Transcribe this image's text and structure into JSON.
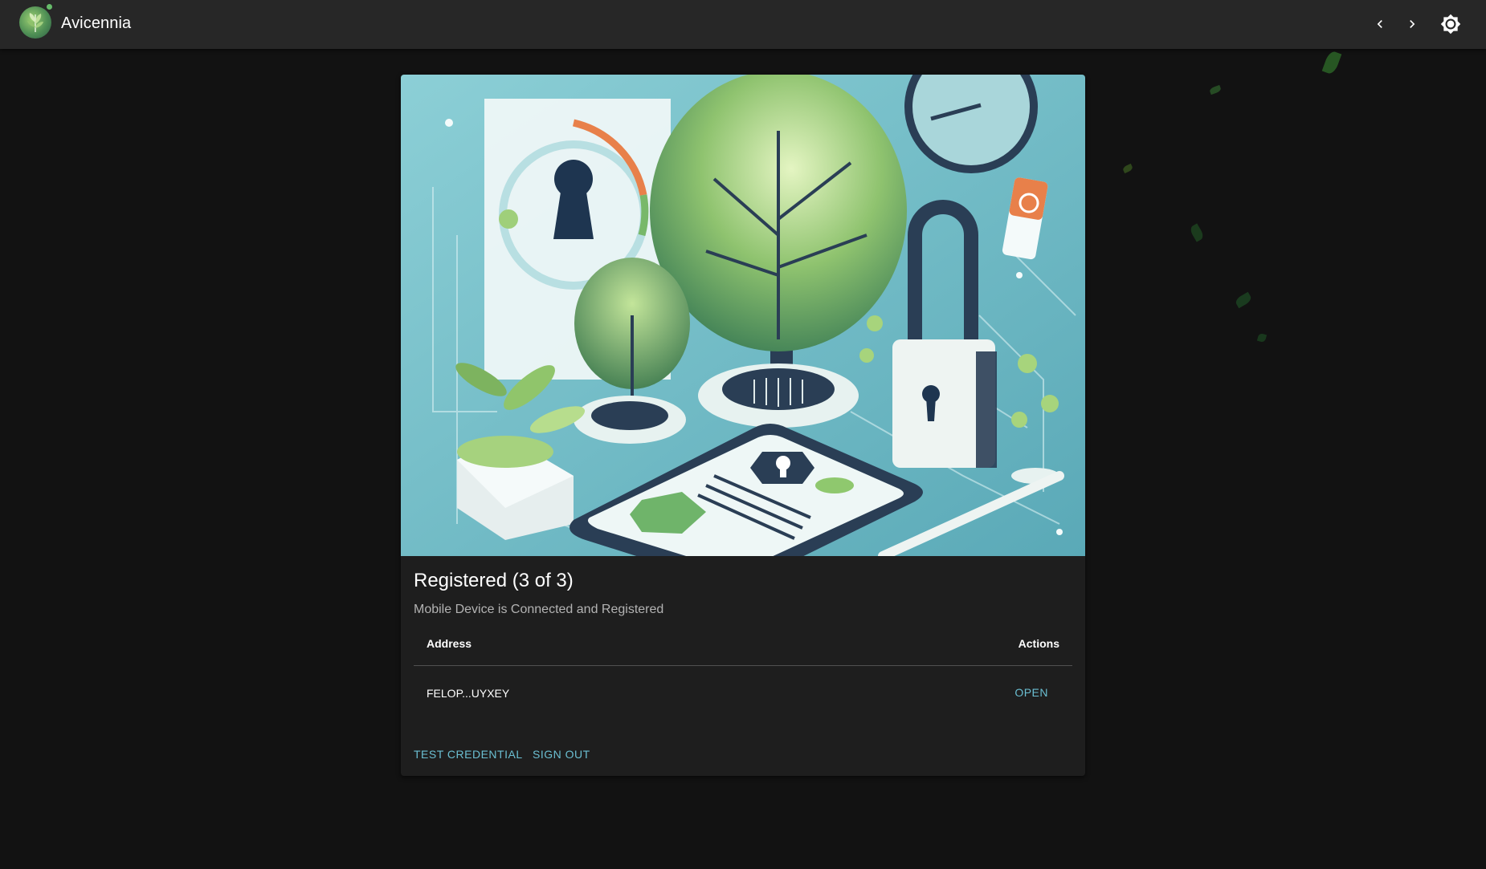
{
  "app": {
    "title": "Avicennia"
  },
  "header": {
    "icons": [
      "chevron-left-icon",
      "chevron-right-icon",
      "brightness-icon"
    ]
  },
  "card": {
    "title": "Registered (3 of 3)",
    "subtitle": "Mobile Device is Connected and Registered",
    "table": {
      "columns": [
        "Address",
        "Actions"
      ],
      "rows": [
        {
          "address": "FELOP...UYXEY",
          "action": "OPEN"
        }
      ]
    },
    "actions": {
      "test_credential": "TEST CREDENTIAL",
      "sign_out": "SIGN OUT"
    }
  },
  "colors": {
    "background": "#121212",
    "appbar": "#272727",
    "card": "#1e1e1e",
    "accent": "#6bbfd2"
  }
}
